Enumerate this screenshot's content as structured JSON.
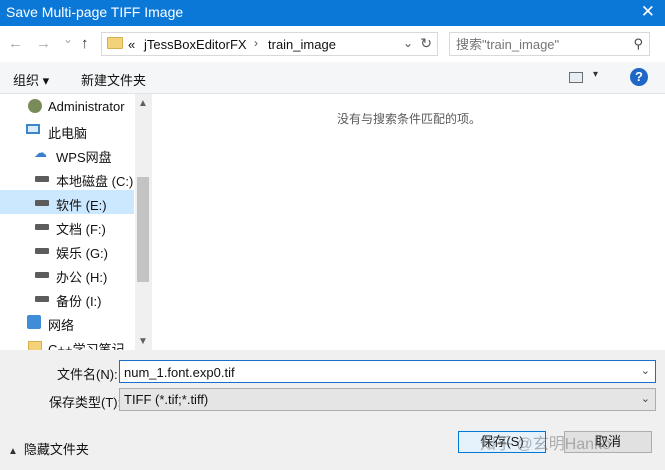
{
  "window": {
    "title": "Save Multi-page TIFF Image",
    "close_glyph": "✕"
  },
  "address": {
    "back_glyph": "←",
    "forward_glyph": "→",
    "history_glyph": "⌄",
    "up_glyph": "↑",
    "chevron": "«",
    "crumbs": [
      "jTessBoxEditorFX",
      "train_image"
    ],
    "separator": "›",
    "dropdown_glyph": "⌄",
    "refresh_glyph": "↻"
  },
  "search": {
    "placeholder": "搜索\"train_image\"",
    "icon": "search-icon"
  },
  "toolbar": {
    "organize_label": "组织 ▾",
    "new_folder_label": "新建文件夹",
    "view_dd": "▾",
    "help": "?"
  },
  "nav": {
    "items": [
      {
        "label": "Administrator",
        "icon": "user-icon"
      },
      {
        "label": "此电脑",
        "icon": "computer-icon"
      },
      {
        "label": "WPS网盘",
        "icon": "cloud-icon"
      },
      {
        "label": "本地磁盘 (C:)",
        "icon": "drive-icon"
      },
      {
        "label": "软件 (E:)",
        "icon": "drive-icon",
        "selected": true
      },
      {
        "label": "文档 (F:)",
        "icon": "drive-icon"
      },
      {
        "label": "娱乐 (G:)",
        "icon": "drive-icon"
      },
      {
        "label": "办公 (H:)",
        "icon": "drive-icon"
      },
      {
        "label": "备份 (I:)",
        "icon": "drive-icon"
      },
      {
        "label": "网络",
        "icon": "network-icon"
      },
      {
        "label": "C++学习笔记",
        "icon": "folder-icon"
      }
    ],
    "scroll_up": "▲",
    "scroll_down": "▼"
  },
  "content": {
    "empty_message": "没有与搜索条件匹配的项。"
  },
  "form": {
    "filename_label": "文件名(N):",
    "filename_value": "num_1.font.exp0.tif",
    "filetype_label": "保存类型(T):",
    "filetype_value": "TIFF (*.tif;*.tiff)",
    "dropdown_glyph": "⌄"
  },
  "footer": {
    "hide_folders_label": "隐藏文件夹",
    "caret": "▲",
    "save_label": "保存(S)",
    "cancel_label": "取消"
  },
  "watermark": "知乎 @玄明Hanko"
}
